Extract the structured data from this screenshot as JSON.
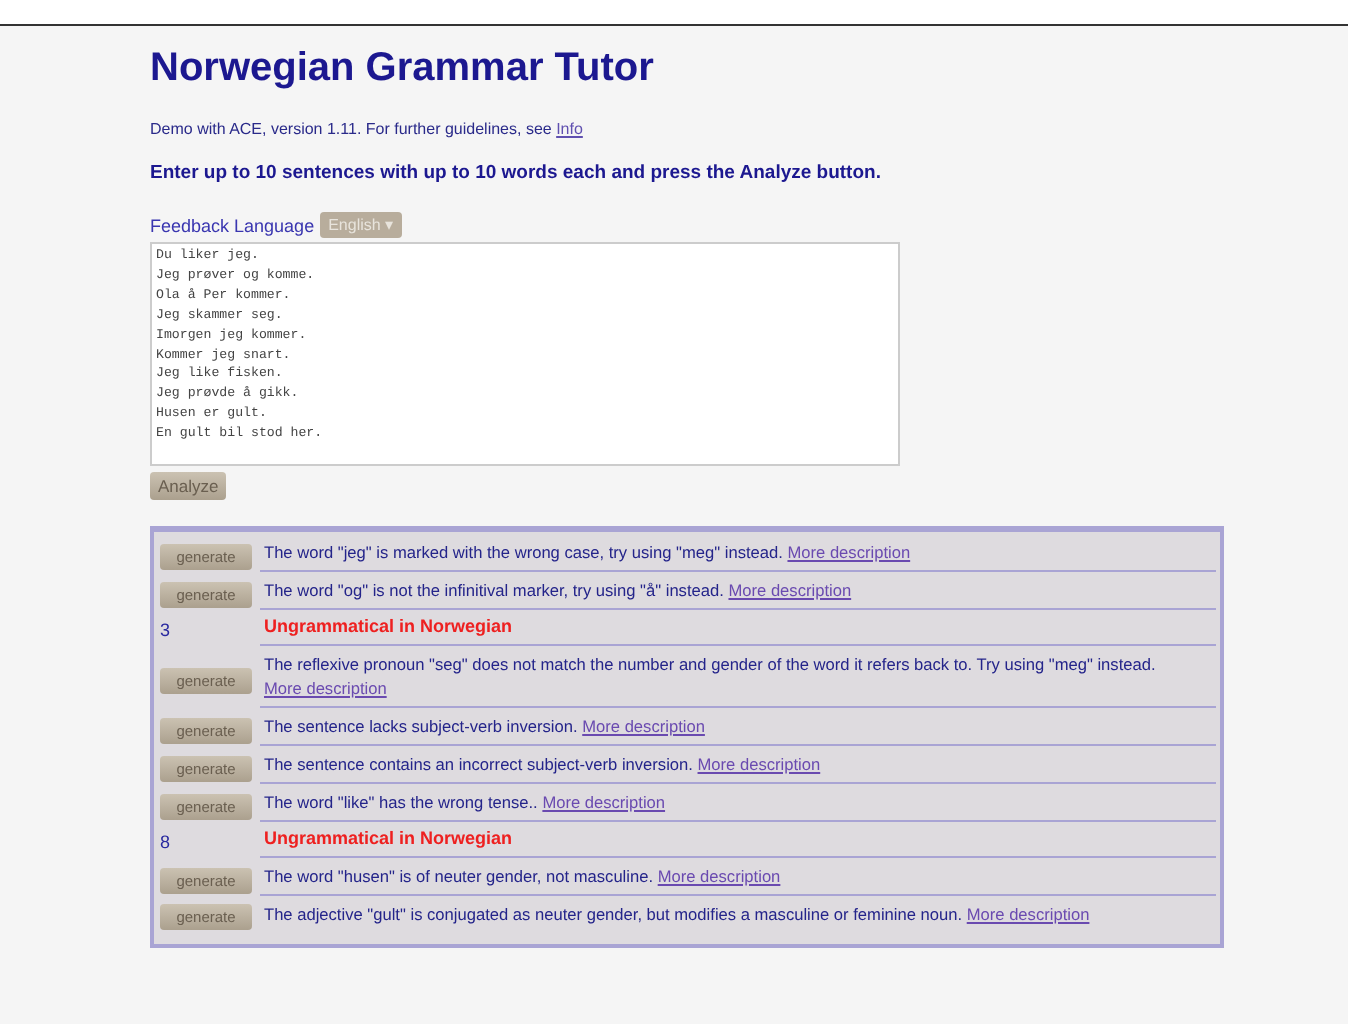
{
  "title": "Norwegian Grammar Tutor",
  "intro": {
    "text": "Demo with ACE, version 1.11. For further guidelines, see",
    "link": "Info"
  },
  "instruction": "Enter up to 10 sentences with up to 10 words each and press the Analyze button.",
  "feedback_language": {
    "label": "Feedback Language",
    "value": "English",
    "caret": "▾"
  },
  "input_text": "Du liker jeg.\nJeg prøver og komme.\nOla å Per kommer.\nJeg skammer seg.\nImorgen jeg kommer.\nKommer jeg snart.\nJeg like fisken.\nJeg prøvde å gikk.\nHusen er gult.\nEn gult bil stod her.",
  "analyze_button": "Analyze",
  "results": [
    {
      "kind": "error",
      "button": "generate",
      "message": "The word \"jeg\" is marked with the wrong case, try using \"meg\" instead.",
      "link": "More description"
    },
    {
      "kind": "error",
      "button": "generate",
      "message": "The word \"og\" is not the infinitival marker, try using \"å\" instead.",
      "link": "More description"
    },
    {
      "kind": "ungrammatical",
      "number": "3",
      "message": "Ungrammatical in Norwegian"
    },
    {
      "kind": "error",
      "button": "generate",
      "message": "The reflexive pronoun \"seg\" does not match the number and gender of the word it refers back to. Try using \"meg\" instead.",
      "link": "More description"
    },
    {
      "kind": "error",
      "button": "generate",
      "message": "The sentence lacks subject-verb inversion.",
      "link": "More description"
    },
    {
      "kind": "error",
      "button": "generate",
      "message": "The sentence contains an incorrect subject-verb inversion.",
      "link": "More description"
    },
    {
      "kind": "error",
      "button": "generate",
      "message": "The word \"like\" has the wrong tense..",
      "link": "More description"
    },
    {
      "kind": "ungrammatical",
      "number": "8",
      "message": "Ungrammatical in Norwegian"
    },
    {
      "kind": "error",
      "button": "generate",
      "message": "The word \"husen\" is of neuter gender, not masculine.",
      "link": "More description"
    },
    {
      "kind": "error",
      "button": "generate",
      "message": "The adjective \"gult\" is conjugated as neuter gender, but modifies a masculine or feminine noun.",
      "link": "More description"
    }
  ]
}
